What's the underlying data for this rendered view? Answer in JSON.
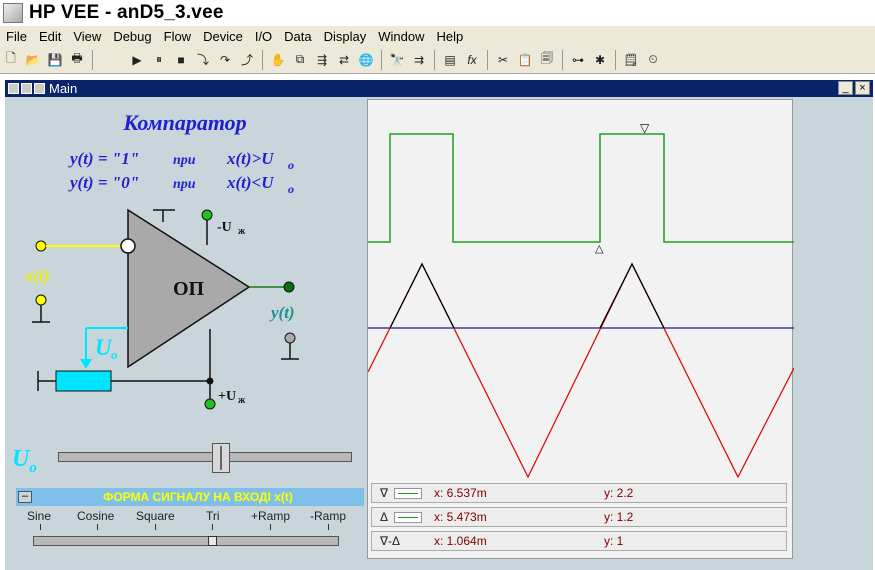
{
  "app": {
    "title": "HP VEE - anD5_3.vee"
  },
  "menu": [
    "File",
    "Edit",
    "View",
    "Debug",
    "Flow",
    "Device",
    "I/O",
    "Data",
    "Display",
    "Window",
    "Help"
  ],
  "toolbar_icons": [
    "new-icon",
    "open-icon",
    "save-icon",
    "print-icon",
    "run-icon",
    "pause-icon",
    "stop-icon",
    "step-into-icon",
    "step-over-icon",
    "step-out-icon",
    "hand-icon",
    "copy-object-icon",
    "trace-icon",
    "probe-icon",
    "globe-icon",
    "find-icon",
    "find-next-icon",
    "properties-icon",
    "formula-icon",
    "cut-icon",
    "paste-icon",
    "delete-icon",
    "connect-icon",
    "bug-icon",
    "notepad-icon",
    "timer-icon"
  ],
  "window": {
    "title": "Main",
    "minimize": "_",
    "close": "×"
  },
  "schematic": {
    "title": "Компаратор",
    "eq1_lhs": "y(t) = \"1\"",
    "eq1_at": "при",
    "eq1_rhs": "x(t)>U",
    "eq2_lhs": "y(t) = \"0\"",
    "eq2_at": "при",
    "eq2_rhs": "x(t)<U",
    "sub": "o",
    "opamp_label": "ОП",
    "neg_supply": "-U",
    "pos_supply": "+U",
    "supply_sub": "ж",
    "input_label": "x(t)",
    "output_label": "y(t)",
    "ref_label": "U",
    "ref_sub": "o"
  },
  "u0_slider": {
    "label": "U",
    "sub": "o",
    "value_fraction": 0.55
  },
  "waveform_selector": {
    "title": "ФОРМА СИГНАЛУ НА ВХОДІ x(t)",
    "options": [
      "Sine",
      "Cosine",
      "Square",
      "Tri",
      "+Ramp",
      "-Ramp"
    ],
    "selected": "Tri"
  },
  "readouts": [
    {
      "marker": "∇",
      "x": "x: 6.537m",
      "y": "y: 2.2"
    },
    {
      "marker": "Δ",
      "x": "x: 5.473m",
      "y": "y: 1.2"
    },
    {
      "marker": "∇-Δ",
      "x": "x: 1.064m",
      "y": "y: 1"
    }
  ],
  "colors": {
    "square": "#1aa01a",
    "tri_above": "#000000",
    "tri_below": "#dd0000",
    "threshold": "#1a1a99",
    "accent": "#0000ff",
    "cyan": "#00e5ff",
    "yellow": "#ffff00"
  }
}
